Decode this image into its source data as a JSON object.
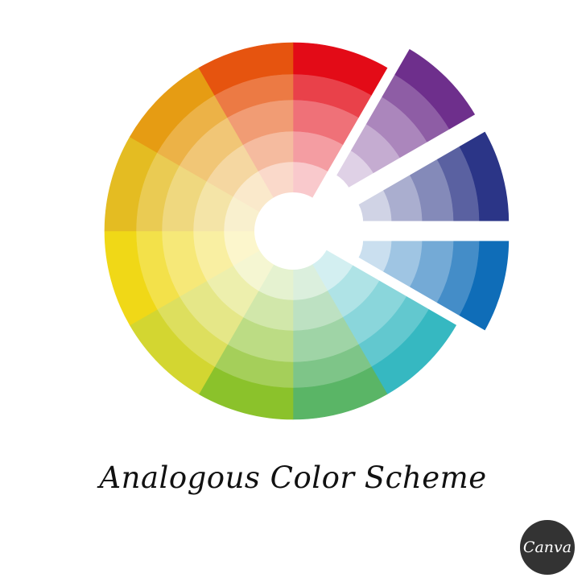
{
  "caption": "Analogous Color Scheme",
  "logo": {
    "text": "Canva"
  },
  "wheel": {
    "center_hole_color": "#ffffff",
    "background": "#ffffff",
    "segments": [
      {
        "hue": "red",
        "color": "#e30b17",
        "highlighted": false
      },
      {
        "hue": "violet",
        "color": "#6e2f8c",
        "highlighted": true
      },
      {
        "hue": "blue-violet",
        "color": "#2b3587",
        "highlighted": true
      },
      {
        "hue": "blue",
        "color": "#0f6db8",
        "highlighted": true
      },
      {
        "hue": "blue-green",
        "color": "#36b8c1",
        "highlighted": false
      },
      {
        "hue": "green",
        "color": "#5ab566",
        "highlighted": false
      },
      {
        "hue": "yellow-green",
        "color": "#8bc22b",
        "highlighted": false
      },
      {
        "hue": "lime",
        "color": "#d3d631",
        "highlighted": false
      },
      {
        "hue": "yellow",
        "color": "#f0d817",
        "highlighted": false
      },
      {
        "hue": "yellow-orange",
        "color": "#e4bc22",
        "highlighted": false
      },
      {
        "hue": "orange",
        "color": "#e69c13",
        "highlighted": false
      },
      {
        "hue": "red-orange",
        "color": "#e6540f",
        "highlighted": false
      }
    ]
  }
}
